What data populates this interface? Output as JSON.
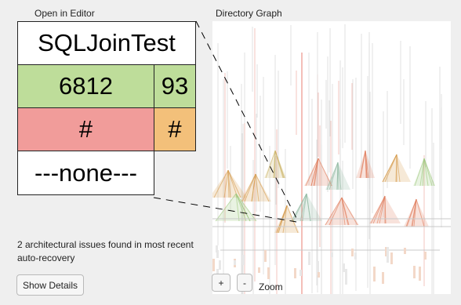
{
  "header": {
    "open_in_editor": "Open in Editor",
    "graph_title": "Directory Graph"
  },
  "tile": {
    "name": "SQLJoinTest",
    "loc": "6812",
    "classes": "93",
    "problem_a": "#",
    "problem_b": "#",
    "status": "---none---"
  },
  "issues_text": "2 architectural issues found in most recent auto-recovery",
  "buttons": {
    "show_details": "Show Details",
    "zoom_in": "+",
    "zoom_out": "-"
  },
  "zoom_label": "Zoom",
  "colors": {
    "green": "#bedd9a",
    "red": "#f19c9a",
    "orange": "#f3c07a"
  }
}
